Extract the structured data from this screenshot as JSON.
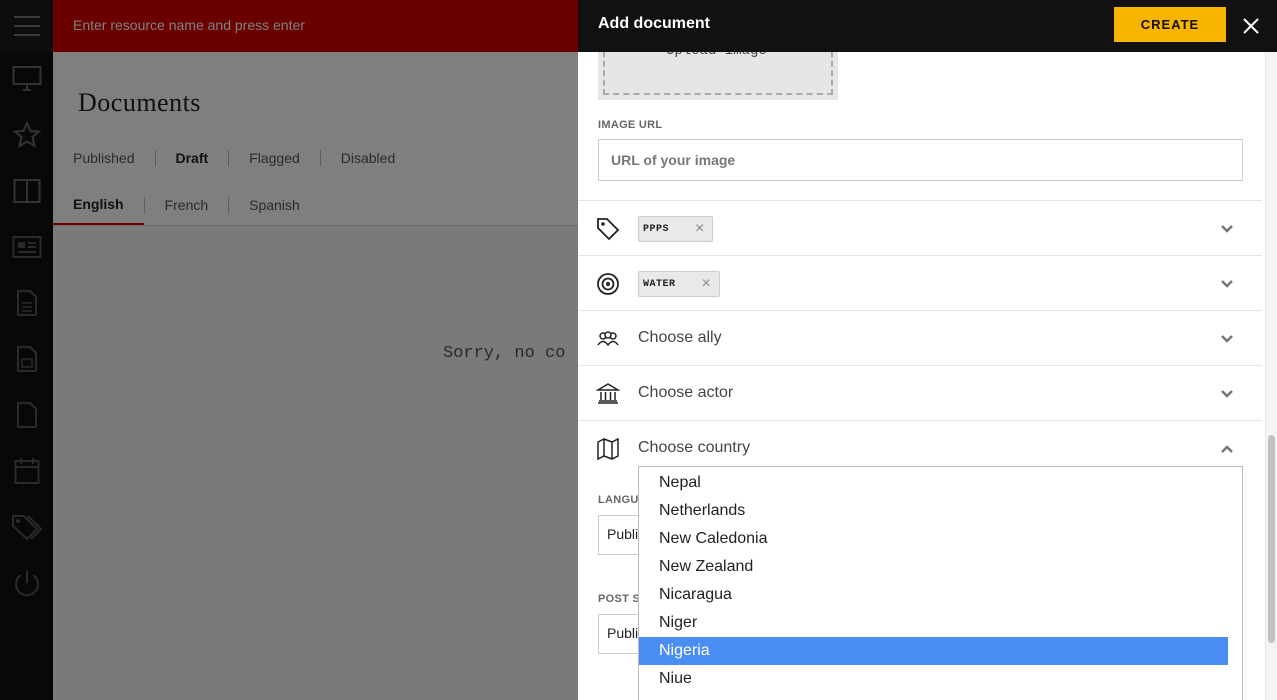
{
  "search": {
    "placeholder": "Enter resource name and press enter"
  },
  "page": {
    "title": "Documents",
    "status_tabs": [
      "Published",
      "Draft",
      "Flagged",
      "Disabled"
    ],
    "active_status": "Draft",
    "language_tabs": [
      "English",
      "French",
      "Spanish"
    ],
    "active_language": "English",
    "empty_message": "Sorry, no co"
  },
  "modal": {
    "title": "Add document",
    "create_label": "CREATE",
    "upload_label": "Upload image",
    "image_url_label": "IMAGE URL",
    "image_url_placeholder": "URL of your image",
    "rows": {
      "tags_chip": "PPPS",
      "target_chip": "WATER",
      "ally": "Choose ally",
      "actor": "Choose actor",
      "country": "Choose country"
    },
    "language_label": "LANGUA",
    "language_value": "Publi",
    "post_status_label": "POST ST",
    "post_status_value": "Publi"
  },
  "country_options": [
    "Nepal",
    "Netherlands",
    "New Caledonia",
    "New Zealand",
    "Nicaragua",
    "Niger",
    "Nigeria",
    "Niue"
  ],
  "selected_country": "Nigeria",
  "icons": [
    "menu-icon",
    "monitor-icon",
    "star-icon",
    "columns-icon",
    "newspaper-icon",
    "document-icon",
    "image-document-icon",
    "file-icon",
    "calendar-icon",
    "tags-icon",
    "power-icon",
    "tag-icon",
    "target-icon",
    "group-icon",
    "institution-icon",
    "map-icon",
    "chevron-down-icon",
    "chevron-up-icon",
    "close-icon"
  ],
  "colors": {
    "brand_red": "#d40000",
    "create_yellow": "#f7b500",
    "selection_blue": "#4a8ef4"
  }
}
